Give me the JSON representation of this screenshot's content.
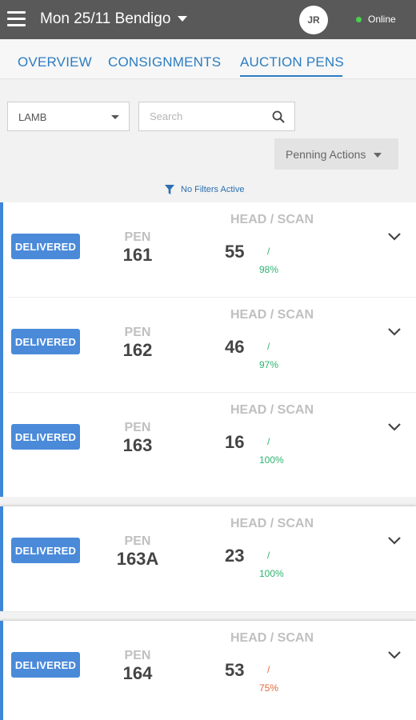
{
  "header": {
    "title": "Mon 25/11 Bendigo",
    "user_initials": "JR",
    "status": "Online"
  },
  "tabs": [
    {
      "label": "OVERVIEW"
    },
    {
      "label": "CONSIGNMENTS"
    },
    {
      "label": "AUCTION PENS",
      "active": true
    }
  ],
  "filters": {
    "category": "LAMB",
    "search_placeholder": "Search",
    "penning_actions": "Penning Actions",
    "status_text": "No Filters Active"
  },
  "pen_column_label": "PEN",
  "head_scan_label": "HEAD / SCAN",
  "pens": [
    {
      "status": "DELIVERED",
      "pen": "161",
      "head": "55",
      "scan_pct": "98%",
      "pct_color": "#2fb36f"
    },
    {
      "status": "DELIVERED",
      "pen": "162",
      "head": "46",
      "scan_pct": "97%",
      "pct_color": "#2fb36f"
    },
    {
      "status": "DELIVERED",
      "pen": "163",
      "head": "16",
      "scan_pct": "100%",
      "pct_color": "#2fb36f"
    },
    {
      "status": "DELIVERED",
      "pen": "163A",
      "head": "23",
      "scan_pct": "100%",
      "pct_color": "#2fb36f"
    },
    {
      "status": "DELIVERED",
      "pen": "164",
      "head": "53",
      "scan_pct": "75%",
      "pct_color": "#e26a3a"
    }
  ],
  "colors": {
    "accent": "#2c7cc1",
    "badge": "#4a8ad9",
    "topbar": "#595959",
    "online": "#46d34b"
  },
  "icons": [
    "menu-icon",
    "caret-down-icon",
    "search-icon",
    "filter-icon",
    "chevron-down-icon"
  ]
}
